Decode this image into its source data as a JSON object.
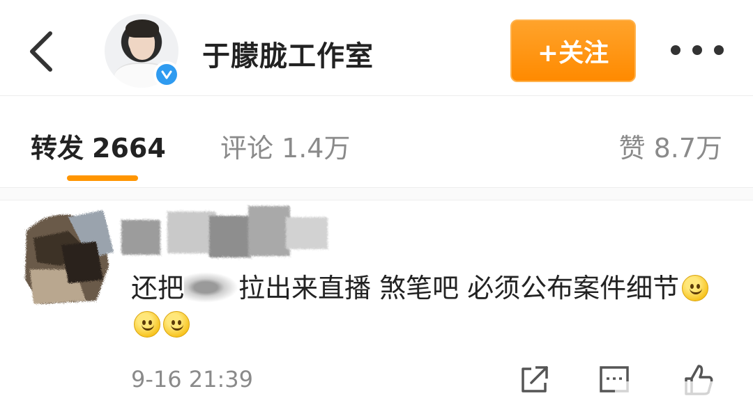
{
  "header": {
    "back_icon": "chevron-left-icon",
    "user_name": "于朦胧工作室",
    "verified_icon": "verified-badge-icon",
    "follow_label": "+关注",
    "more_icon": "more-dots-icon"
  },
  "stats": {
    "repost_label": "转发",
    "repost_count": "2664",
    "comment_label": "评论",
    "comment_count": "1.4万",
    "like_label": "赞",
    "like_count": "8.7万",
    "active_tab": "转发"
  },
  "comment": {
    "text_before": "还把",
    "text_after": "拉出来直播 煞笔吧 必须公布案件细节",
    "emoji_icon": "smile-emoji-icon",
    "timestamp": "9-16 21:39",
    "actions": [
      "share-icon",
      "comment-icon",
      "like-icon"
    ]
  },
  "colors": {
    "accent": "#ff9500",
    "follow_bg": "#ff8a00",
    "verified": "#2f9bf0",
    "muted_text": "#8a8a8a"
  }
}
